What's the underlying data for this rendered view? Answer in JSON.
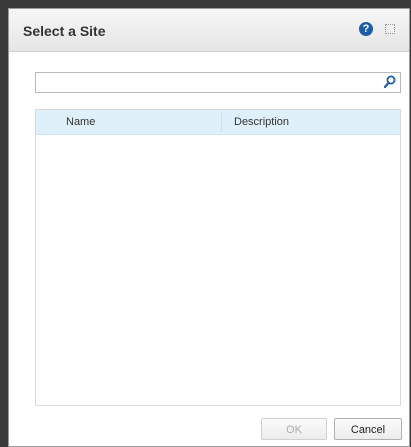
{
  "dialog": {
    "title": "Select a Site",
    "help_icon": "question-icon",
    "help_glyph": "?",
    "maximize_icon": "maximize-icon"
  },
  "search": {
    "value": "",
    "placeholder": "",
    "icon": "search-icon"
  },
  "grid": {
    "columns": [
      "Name",
      "Description"
    ],
    "rows": []
  },
  "buttons": {
    "ok_label": "OK",
    "ok_enabled": false,
    "cancel_label": "Cancel"
  }
}
